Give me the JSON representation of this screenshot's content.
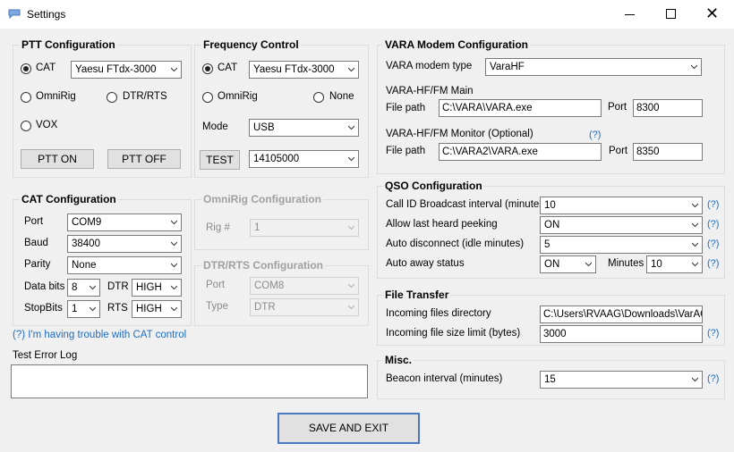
{
  "window": {
    "title": "Settings"
  },
  "ptt": {
    "title": "PTT Configuration",
    "cat_label": "CAT",
    "cat_radio_model": "Yaesu FTdx-3000",
    "omnirig_label": "OmniRig",
    "dtrrts_label": "DTR/RTS",
    "vox_label": "VOX",
    "ptt_on_label": "PTT ON",
    "ptt_off_label": "PTT OFF"
  },
  "freq": {
    "title": "Frequency Control",
    "cat_label": "CAT",
    "cat_radio_model": "Yaesu FTdx-3000",
    "omnirig_label": "OmniRig",
    "none_label": "None",
    "mode_label": "Mode",
    "mode_value": "USB",
    "test_label": "TEST",
    "frequency_value": "14105000"
  },
  "cat": {
    "title": "CAT Configuration",
    "port_label": "Port",
    "port_value": "COM9",
    "baud_label": "Baud",
    "baud_value": "38400",
    "parity_label": "Parity",
    "parity_value": "None",
    "databits_label": "Data bits",
    "databits_value": "8",
    "dtr_label": "DTR",
    "dtr_value": "HIGH",
    "stopbits_label": "StopBits",
    "stopbits_value": "1",
    "rts_label": "RTS",
    "rts_value": "HIGH",
    "trouble_link": "(?) I'm having trouble with CAT control"
  },
  "omnirig": {
    "title": "OmniRig Configuration",
    "rig_label": "Rig #",
    "rig_value": "1"
  },
  "dtrrts": {
    "title": "DTR/RTS Configuration",
    "port_label": "Port",
    "port_value": "COM8",
    "type_label": "Type",
    "type_value": "DTR"
  },
  "errorlog": {
    "label": "Test Error Log",
    "value": ""
  },
  "vara": {
    "title": "VARA Modem Configuration",
    "type_label": "VARA modem type",
    "type_value": "VaraHF",
    "main_label": "VARA-HF/FM Main",
    "main_filepath_label": "File path",
    "main_filepath_value": "C:\\VARA\\VARA.exe",
    "main_port_label": "Port",
    "main_port_value": "8300",
    "monitor_label": "VARA-HF/FM Monitor (Optional)",
    "monitor_help": "(?)",
    "monitor_filepath_label": "File path",
    "monitor_filepath_value": "C:\\VARA2\\VARA.exe",
    "monitor_port_label": "Port",
    "monitor_port_value": "8350"
  },
  "qso": {
    "title": "QSO Configuration",
    "callid_label": "Call ID Broadcast interval (minutes)",
    "callid_value": "10",
    "lastheard_label": "Allow last heard peeking",
    "lastheard_value": "ON",
    "autodisc_label": "Auto disconnect (idle minutes)",
    "autodisc_value": "5",
    "autoaway_label": "Auto away status",
    "autoaway_value": "ON",
    "minutes_label": "Minutes",
    "minutes_value": "10",
    "help": "(?)"
  },
  "filetransfer": {
    "title": "File Transfer",
    "dir_label": "Incoming files directory",
    "dir_value": "C:\\Users\\RVAAG\\Downloads\\VarAC",
    "limit_label": "Incoming file size limit (bytes)",
    "limit_value": "3000",
    "help": "(?)"
  },
  "misc": {
    "title": "Misc.",
    "beacon_label": "Beacon interval (minutes)",
    "beacon_value": "15",
    "help": "(?)"
  },
  "save_label": "SAVE AND EXIT",
  "colors": {
    "link": "#1f6bbf",
    "disabled": "#8a8a8a",
    "background": "#f0f0f0"
  }
}
